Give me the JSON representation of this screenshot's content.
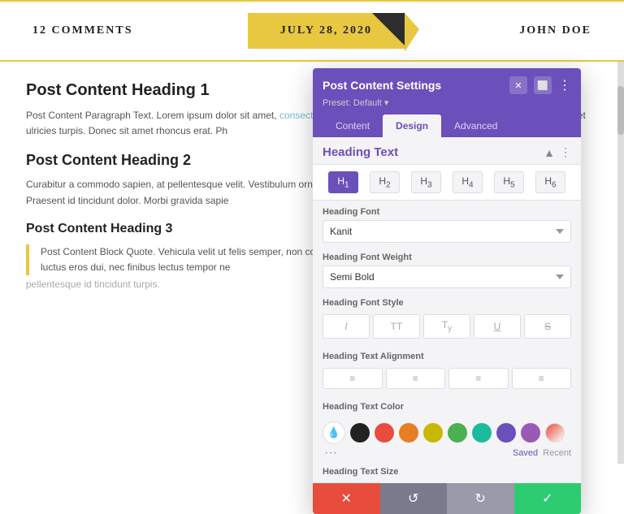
{
  "topbar": {
    "left": "12 COMMENTS",
    "center": "JULY 28, 2020",
    "right": "JOHN DOE"
  },
  "article": {
    "heading1": "Post Content Heading 1",
    "para1": "Post Content Paragraph Text. Lorem ipsum dolor sit amet, consectetur adipiscing elit. Ut egestas orci vel ornare venenatis. Sed et ulricies turpis. Donec sit amet rhoncus erat. Ph",
    "link1": "consectetur adipiscing elit.",
    "heading2": "Post Content Heading 2",
    "para2": "Curabitur a commodo sapien, at pellentesque velit. Vestibulum ornare vulputate. Mauris amet. In hac habitasse platea dictumst. Praesent id tincidunt dolor. Morbi gravida sapie",
    "heading3": "Post Content Heading 3",
    "blockquote": "Post Content Block Quote. Vehicula velit ut felis semper, non convallis dolor fermen quis leo. Integer nec suscipit lacus. Duis luctus eros dui, nec finibus lectus tempor ne",
    "blurred": "pellentesque id tincidunt turpis."
  },
  "panel": {
    "title": "Post Content Settings",
    "preset": "Preset: Default ▾",
    "tabs": [
      "Content",
      "Design",
      "Advanced"
    ],
    "active_tab": "Design",
    "section": {
      "heading": "Heading Text",
      "h_buttons": [
        "H₁",
        "H₂",
        "H₃",
        "H₄",
        "H₅",
        "H₆"
      ]
    },
    "heading_font_label": "Heading Font",
    "heading_font_value": "Kanit",
    "heading_font_weight_label": "Heading Font Weight",
    "heading_font_weight_value": "Semi Bold",
    "heading_font_style_label": "Heading Font Style",
    "font_style_buttons": [
      "I",
      "TT",
      "T",
      "U",
      "S"
    ],
    "heading_text_align_label": "Heading Text Alignment",
    "heading_text_color_label": "Heading Text Color",
    "colors": [
      "#222222",
      "#e74c3c",
      "#e67e22",
      "#f1c40f",
      "#2ecc71",
      "#1abc9c",
      "#6b4fbb",
      "#9b59b6"
    ],
    "color_saved": "Saved",
    "color_recent": "Recent",
    "heading_text_size_label": "Heading Text Size",
    "footer_buttons": [
      "✕",
      "↺",
      "↻",
      "✓"
    ]
  }
}
